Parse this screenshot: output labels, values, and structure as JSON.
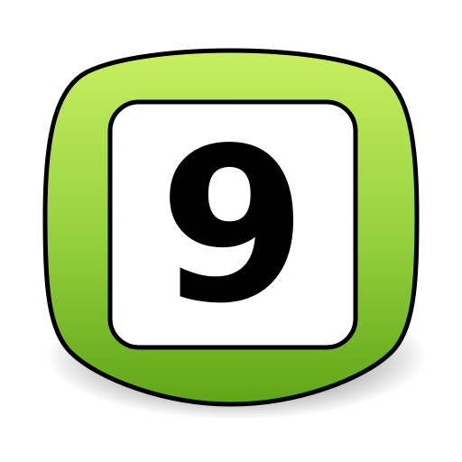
{
  "badge": {
    "number": "9",
    "icon": "number-nine-icon",
    "colors": {
      "green_light": "#c8ef5f",
      "green_mid": "#93cf3c",
      "green_dark": "#5fa616",
      "outline": "#000000",
      "inner_fill": "#ffffff",
      "digit": "#000000"
    }
  }
}
